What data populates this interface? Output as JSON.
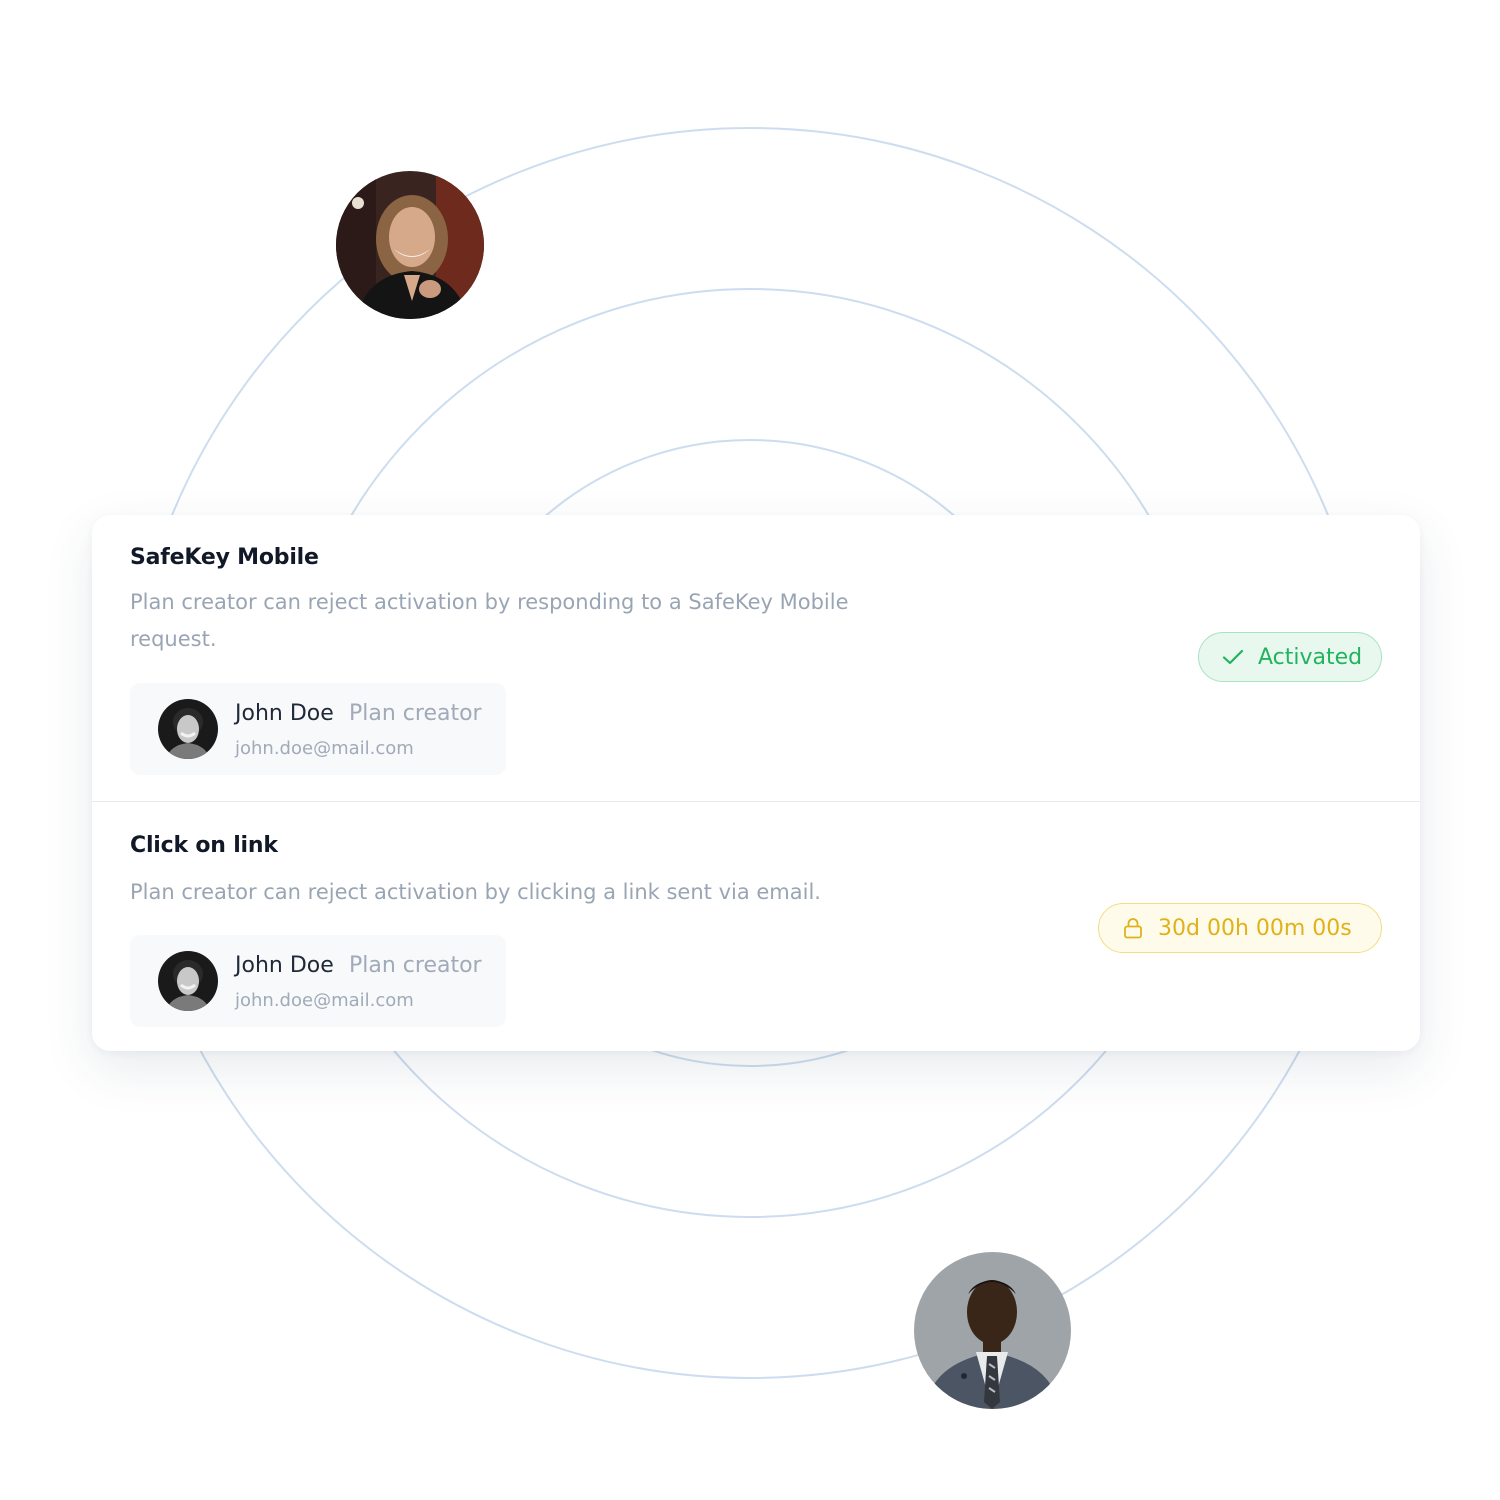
{
  "colors": {
    "ring": "#cdddef",
    "card_background": "#ffffff",
    "title_text": "#111827",
    "muted_text": "#9aa5b4",
    "activated_green": "#22b35e",
    "activated_bg": "#e9f8ef",
    "timer_yellow": "#e0b21a",
    "timer_bg": "#fffbea"
  },
  "floating_avatars": [
    {
      "name": "woman-avatar"
    },
    {
      "name": "man-in-suit-avatar"
    }
  ],
  "sections": [
    {
      "title": "SafeKey Mobile",
      "description": "Plan creator can reject activation by responding to a SafeKey Mobile request.",
      "user": {
        "name": "John Doe",
        "role": "Plan creator",
        "email": "john.doe@mail.com"
      },
      "status": {
        "label": "Activated",
        "icon": "check-icon"
      }
    },
    {
      "title": "Click on link",
      "description": "Plan creator can reject activation by clicking a link sent via email.",
      "user": {
        "name": "John Doe",
        "role": "Plan creator",
        "email": "john.doe@mail.com"
      },
      "status": {
        "label": "30d 00h 00m 00s",
        "icon": "lock-icon"
      }
    }
  ]
}
